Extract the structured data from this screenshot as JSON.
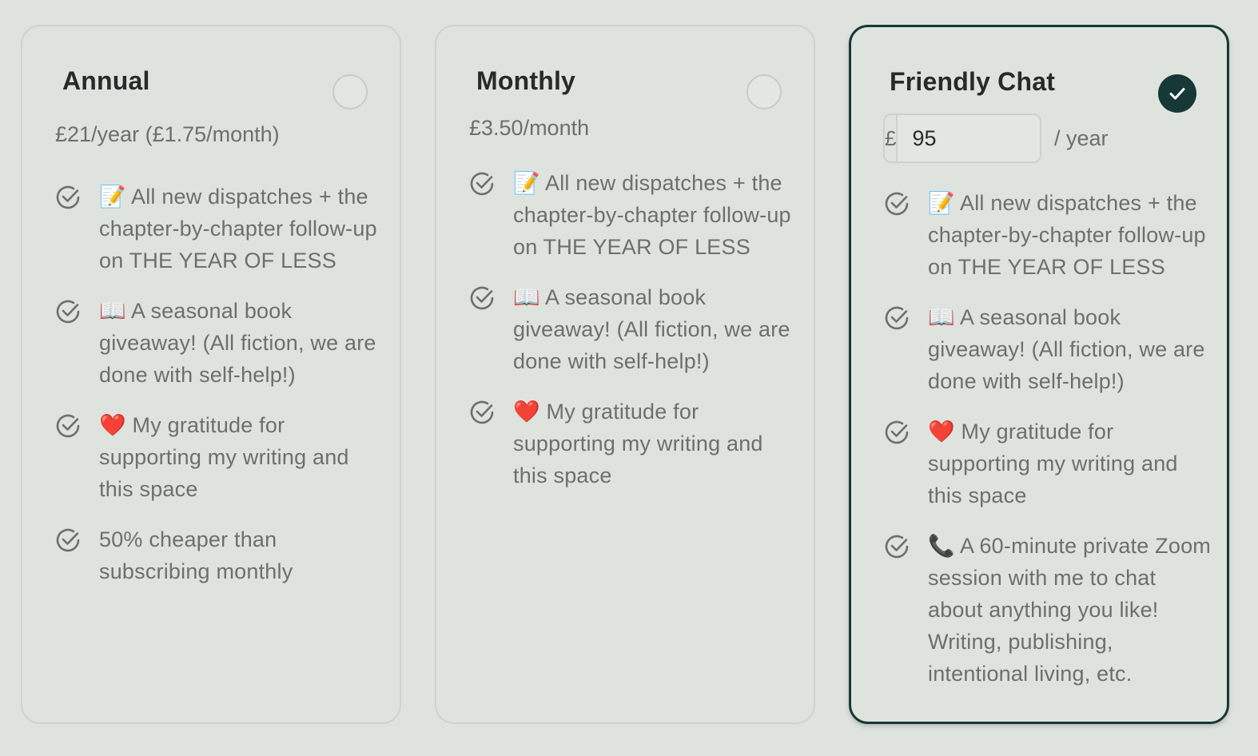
{
  "plans": [
    {
      "name": "Annual",
      "price": "£21/year (£1.75/month)",
      "selected": false,
      "features": [
        "📝 All new dispatches + the chapter-by-chapter follow-up on THE YEAR OF LESS",
        "📖 A seasonal book giveaway! (All fiction, we are done with self-help!)",
        "❤️ My gratitude for supporting my writing and this space",
        "50% cheaper than subscribing monthly"
      ]
    },
    {
      "name": "Monthly",
      "price": "£3.50/month",
      "selected": false,
      "features": [
        "📝 All new dispatches + the chapter-by-chapter follow-up on THE YEAR OF LESS",
        "📖 A seasonal book giveaway! (All fiction, we are done with self-help!)",
        "❤️ My gratitude for supporting my writing and this space"
      ]
    },
    {
      "name": "Friendly Chat",
      "currency_symbol": "£",
      "amount": "95",
      "interval": "/ year",
      "selected": true,
      "features": [
        "📝 All new dispatches + the chapter-by-chapter follow-up on THE YEAR OF LESS",
        "📖 A seasonal book giveaway! (All fiction, we are done with self-help!)",
        "❤️ My gratitude for supporting my writing and this space",
        "📞 A 60-minute private Zoom session with me to chat about anything you like! Writing, publishing, intentional living, etc."
      ]
    }
  ],
  "colors": {
    "background": "#dfe3de",
    "selected_border": "#163837",
    "text_primary": "#262b2a",
    "text_secondary": "#6b706e",
    "check_icon": "#6b706e"
  },
  "icons": {
    "feature": "circle-check-icon",
    "selected": "checkmark-icon",
    "unselected": "radio-circle-icon"
  }
}
